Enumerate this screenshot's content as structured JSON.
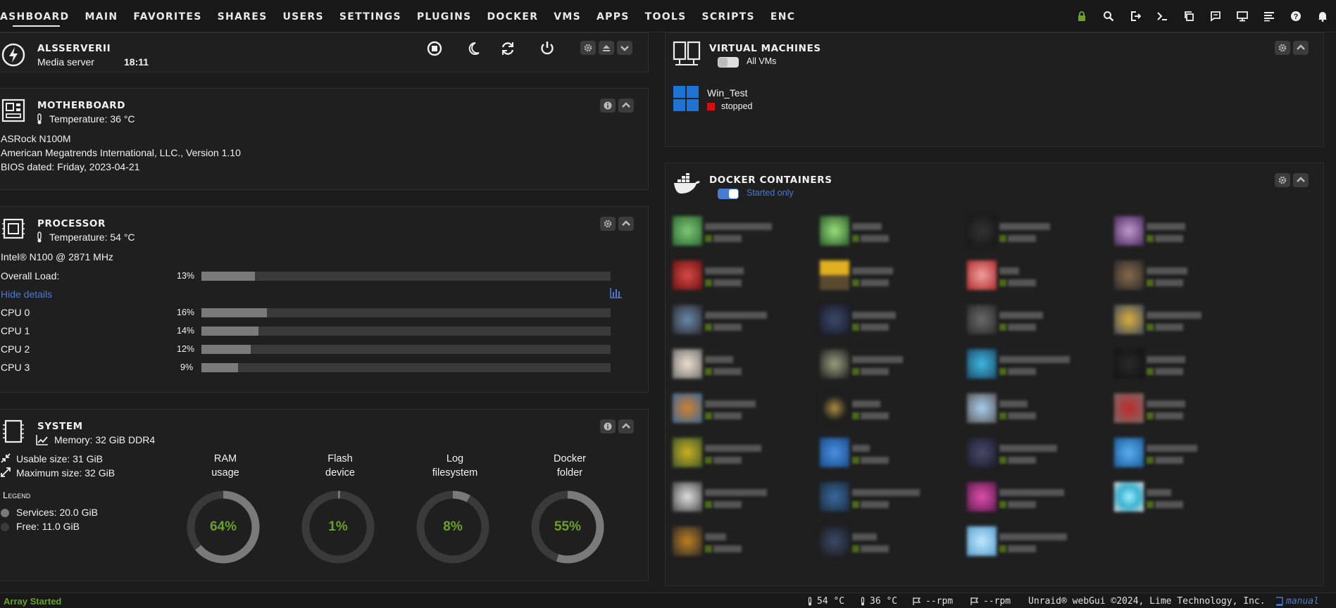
{
  "nav": {
    "tabs": [
      "ASHBOARD",
      "MAIN",
      "FAVORITES",
      "SHARES",
      "USERS",
      "SETTINGS",
      "PLUGINS",
      "DOCKER",
      "VMS",
      "APPS",
      "TOOLS",
      "SCRIPTS",
      "ENC"
    ],
    "icons": [
      "lock-icon",
      "search-icon",
      "logout-icon",
      "terminal-icon",
      "copy-icon",
      "feedback-icon",
      "display-icon",
      "log-icon",
      "help-icon",
      "bell-icon"
    ]
  },
  "server": {
    "name": "ALSSERVERII",
    "description": "Media server",
    "time": "18:11"
  },
  "motherboard": {
    "title": "MOTHERBOARD",
    "temperature": "Temperature: 36 °C",
    "model": "ASRock N100M",
    "bios_vendor": "American Megatrends International, LLC., Version 1.10",
    "bios_date": "BIOS dated: Friday, 2023-04-21"
  },
  "processor": {
    "title": "PROCESSOR",
    "temperature": "Temperature: 54 °C",
    "model": "Intel® N100 @ 2871 MHz",
    "overall_label": "Overall Load:",
    "overall_pct": "13%",
    "overall_value": 13,
    "hide_details": "Hide details",
    "cpus": [
      {
        "label": "CPU 0",
        "pct": "16%",
        "value": 16
      },
      {
        "label": "CPU 1",
        "pct": "14%",
        "value": 14
      },
      {
        "label": "CPU 2",
        "pct": "12%",
        "value": 12
      },
      {
        "label": "CPU 3",
        "pct": "9%",
        "value": 9
      }
    ]
  },
  "system": {
    "title": "SYSTEM",
    "memory": "Memory: 32 GiB DDR4",
    "usable": "Usable size: 31 GiB",
    "maximum": "Maximum size: 32 GiB",
    "legend_title": "Legend",
    "legend": [
      {
        "label": "Services: 20.0 GiB",
        "color": "#7a7a7a"
      },
      {
        "label": "Free: 11.0 GiB",
        "color": "#3a3a3a"
      }
    ],
    "gauges": [
      {
        "line1": "RAM",
        "line2": "usage",
        "pct": "64%",
        "value": 64
      },
      {
        "line1": "Flash",
        "line2": "device",
        "pct": "1%",
        "value": 1
      },
      {
        "line1": "Log",
        "line2": "filesystem",
        "pct": "8%",
        "value": 8
      },
      {
        "line1": "Docker",
        "line2": "folder",
        "pct": "55%",
        "value": 55
      }
    ]
  },
  "vms": {
    "title": "VIRTUAL MACHINES",
    "toggle_label": "All VMs",
    "items": [
      {
        "name": "Win_Test",
        "state": "stopped",
        "state_color": "#d01010"
      }
    ]
  },
  "docker": {
    "title": "DOCKER CONTAINERS",
    "toggle_label": "Started only"
  },
  "footer": {
    "status": "Array Started",
    "cpu_temp": "54 °C",
    "mb_temp": "36 °C",
    "fan1": "--rpm",
    "fan2": "--rpm",
    "copyright": "Unraid® webGui ©2024, Lime Technology, Inc.",
    "manual": "manual"
  },
  "colors": {
    "accent_green": "#6ba02a",
    "link_blue": "#4a7bd0",
    "panel_bg": "#1f1f1f"
  }
}
